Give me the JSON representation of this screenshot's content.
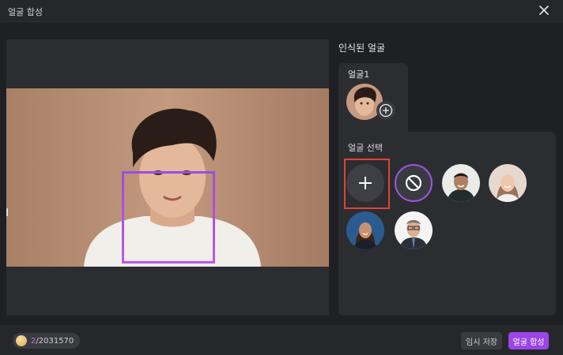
{
  "window": {
    "title": "얼굴 합성"
  },
  "panel": {
    "detected_title": "인식된 얼굴",
    "face_tab_label": "얼굴1",
    "select_label": "얼굴 선택"
  },
  "face_options": [
    "add",
    "none",
    "man-portrait",
    "woman-portrait",
    "woman-portrait-2",
    "man-portrait-2"
  ],
  "bottom": {
    "credits_current": "2",
    "credits_total": "/2031570",
    "temp_save_label": "임시 저장",
    "compose_label": "얼굴 합성"
  },
  "colors": {
    "accent": "#9b45e6",
    "face_box": "#b052e6",
    "highlight_frame": "#e0413a"
  }
}
